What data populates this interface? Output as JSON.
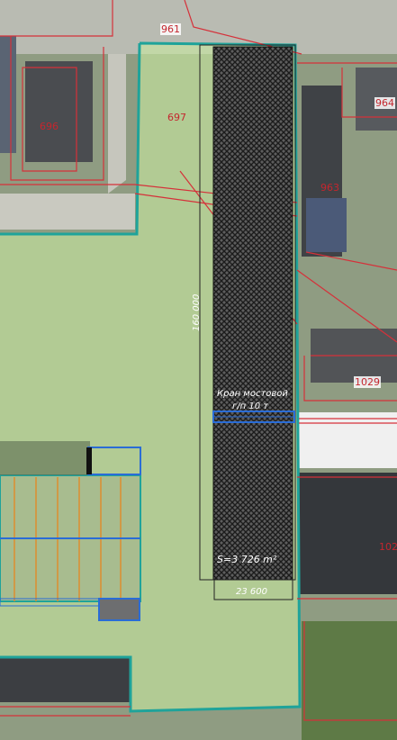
{
  "parcels": {
    "p961": "961",
    "p696": "696",
    "p697": "697",
    "p964": "964",
    "p963": "963",
    "p1029": "1029",
    "p102": "102"
  },
  "annotations": {
    "crane_line1": "Кран мостовой",
    "crane_line2": "г/п 10 т",
    "area": "S=3 726 m²",
    "width_dim": "23 600",
    "length_dim": "160 000"
  },
  "colors": {
    "boundary_teal": "#1fa39a",
    "cadastral_red": "#d5313a",
    "highlight_green": "#c8e8a0",
    "hatch": "#222222",
    "crane_blue": "#2a6cd6",
    "orange_rail": "#e08a28"
  }
}
